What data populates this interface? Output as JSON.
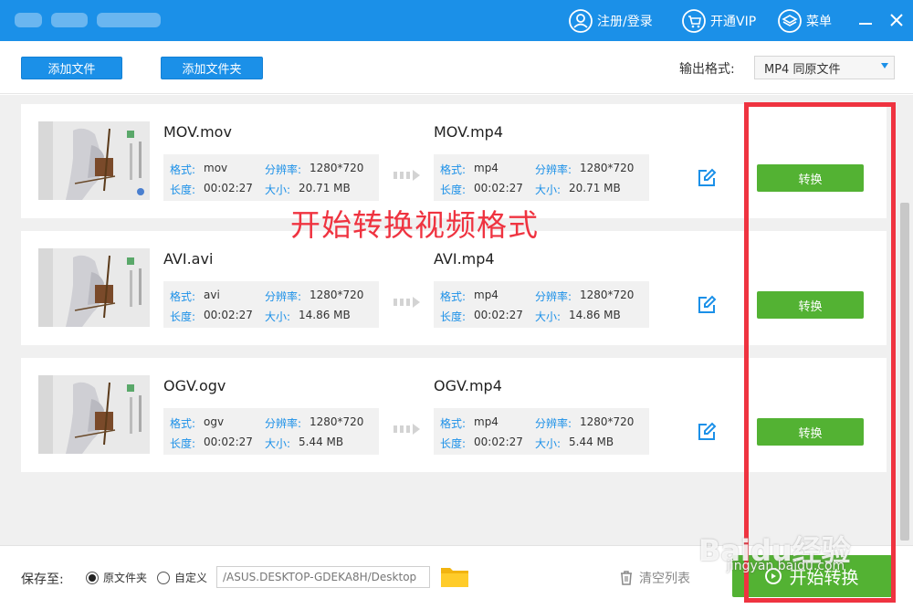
{
  "titlebar": {
    "register_label": "注册/登录",
    "vip_label": "开通VIP",
    "menu_label": "菜单",
    "bg_color": "#1b90e8"
  },
  "toolbar": {
    "add_file_label": "添加文件",
    "add_folder_label": "添加文件夹",
    "output_format_label": "输出格式:",
    "output_format_value": "MP4  同原文件"
  },
  "files": [
    {
      "src_name": "MOV.mov",
      "src": {
        "format_key": "格式:",
        "format": "mov",
        "res_key": "分辨率:",
        "res": "1280*720",
        "len_key": "长度:",
        "len": "00:02:27",
        "size_key": "大小:",
        "size": "20.71 MB"
      },
      "dst_name": "MOV.mp4",
      "dst": {
        "format_key": "格式:",
        "format": "mp4",
        "res_key": "分辨率:",
        "res": "1280*720",
        "len_key": "长度:",
        "len": "00:02:27",
        "size_key": "大小:",
        "size": "20.71 MB"
      },
      "convert_label": "转换"
    },
    {
      "src_name": "AVI.avi",
      "src": {
        "format_key": "格式:",
        "format": "avi",
        "res_key": "分辨率:",
        "res": "1280*720",
        "len_key": "长度:",
        "len": "00:02:27",
        "size_key": "大小:",
        "size": "14.86 MB"
      },
      "dst_name": "AVI.mp4",
      "dst": {
        "format_key": "格式:",
        "format": "mp4",
        "res_key": "分辨率:",
        "res": "1280*720",
        "len_key": "长度:",
        "len": "00:02:27",
        "size_key": "大小:",
        "size": "14.86 MB"
      },
      "convert_label": "转换"
    },
    {
      "src_name": "OGV.ogv",
      "src": {
        "format_key": "格式:",
        "format": "ogv",
        "res_key": "分辨率:",
        "res": "1280*720",
        "len_key": "长度:",
        "len": "00:02:27",
        "size_key": "大小:",
        "size": "5.44 MB"
      },
      "dst_name": "OGV.mp4",
      "dst": {
        "format_key": "格式:",
        "format": "mp4",
        "res_key": "分辨率:",
        "res": "1280*720",
        "len_key": "长度:",
        "len": "00:02:27",
        "size_key": "大小:",
        "size": "5.44 MB"
      },
      "convert_label": "转换"
    }
  ],
  "annotation": {
    "text": "开始转换视频格式",
    "color": "#ef3340"
  },
  "bottom": {
    "save_to_label": "保存至:",
    "radio_original_label": "原文件夹",
    "radio_custom_label": "自定义",
    "path_value": "/ASUS.DESKTOP-GDEKA8H/Desktop",
    "clear_list_label": "清空列表",
    "start_convert_label": "开始转换"
  },
  "watermark": {
    "text": "Baidu经验",
    "url": "jingyan.baidu.com"
  },
  "colors": {
    "accent_blue": "#1b90e8",
    "convert_green": "#53b233"
  }
}
